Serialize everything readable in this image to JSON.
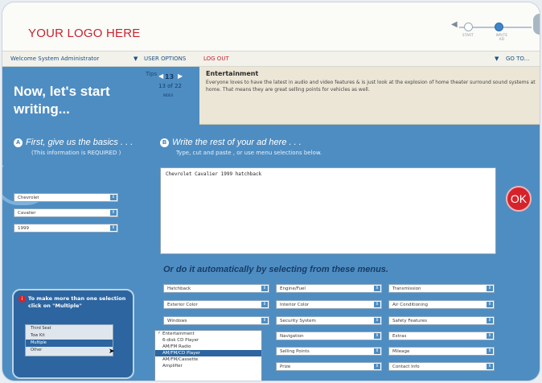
{
  "header": {
    "logo": "YOUR LOGO HERE",
    "steps": [
      {
        "label": "START"
      },
      {
        "label": "WRITE AD"
      },
      {
        "label": ""
      }
    ]
  },
  "navbar": {
    "welcome": "Welcome System Administrator",
    "user_options": "USER OPTIONS",
    "logout": "LOG OUT",
    "goto": "GO TO..."
  },
  "main": {
    "title": "Now, let's start writing...",
    "tips": {
      "label": "Tips",
      "current": "13",
      "count": "13  of  22",
      "index": "INDEX"
    },
    "tip": {
      "title": "Entertainment",
      "body": "Everyone loves to have the latest in audio and video features & is just look at the explosion of home theater surround sound systems at home. That means they are great selling points for vehicles as well."
    },
    "section_a": {
      "badge": "A",
      "title": "First, give us the basics . . .",
      "sub": "(This information is REQUIRED )"
    },
    "section_b": {
      "badge": "B",
      "title": "Write the rest of your ad here . . .",
      "sub": "Type, cut and paste , or use menu selections below."
    },
    "basics": [
      {
        "value": "Chevrolet"
      },
      {
        "value": "Cavalier"
      },
      {
        "value": "1999"
      }
    ],
    "ad_text": "Chevrolet Cavalier 1999 hatchback",
    "ok_label": "OK",
    "menus_title": "Or do it automatically by selecting from these menus.",
    "menus": [
      [
        "Hatchback",
        "Engine/Fuel",
        "Transmission"
      ],
      [
        "Exterior Color",
        "Interior Color",
        "Air Conditioning"
      ],
      [
        "Windows",
        "Security System",
        "Safety Features"
      ],
      [
        "",
        "Navigation",
        "Extras"
      ],
      [
        "",
        "Selling Points",
        "Mileage"
      ],
      [
        "",
        "Prize",
        "Contact Info"
      ]
    ],
    "multi_help": {
      "text": "To make more than one selection click on \"Multiple\"",
      "options": [
        "Third Seat",
        "Tow Kit",
        "Multiple",
        "Other"
      ]
    },
    "dropdown": {
      "options": [
        "Entertainment",
        "6-disk CD Player",
        "AM/FM Radio",
        "AM/FM/CD Player",
        "AM/FM/Cassette",
        "Amplifier"
      ]
    }
  },
  "colors": {
    "main_blue": "#4e8dc2",
    "accent_red": "#d6232b",
    "dark_blue": "#2c65a0"
  }
}
